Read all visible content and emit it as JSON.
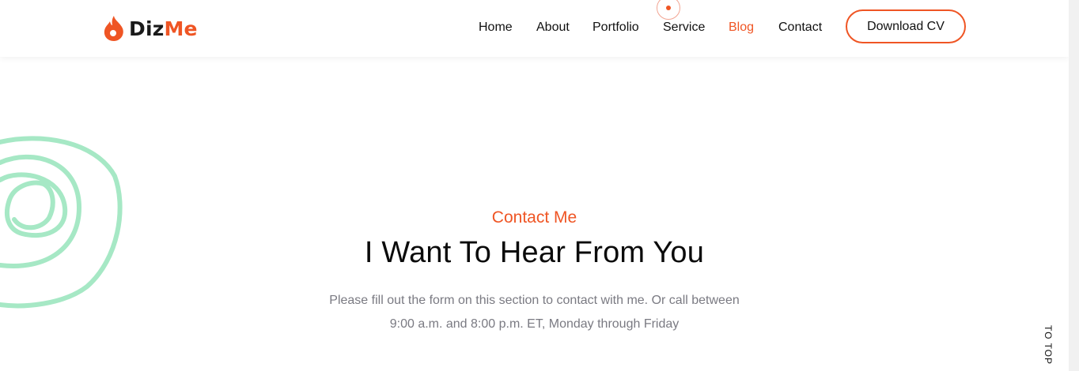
{
  "brand": {
    "name_part1": "Diz",
    "name_part2": "Me",
    "accent_color": "#ef5524"
  },
  "nav": {
    "items": [
      {
        "label": "Home"
      },
      {
        "label": "About"
      },
      {
        "label": "Portfolio"
      },
      {
        "label": "Service"
      },
      {
        "label": "Blog",
        "active": true
      },
      {
        "label": "Contact"
      }
    ],
    "cta_label": "Download CV"
  },
  "contact": {
    "subtitle": "Contact Me",
    "title": "I Want To Hear From You",
    "text_line1": "Please fill out the form on this section to contact with me. Or call between",
    "text_line2": "9:00 a.m. and 8:00 p.m. ET, Monday through Friday"
  },
  "to_top_label": "TO TOP",
  "decor": {
    "spiral_color": "#a6e8c5"
  }
}
